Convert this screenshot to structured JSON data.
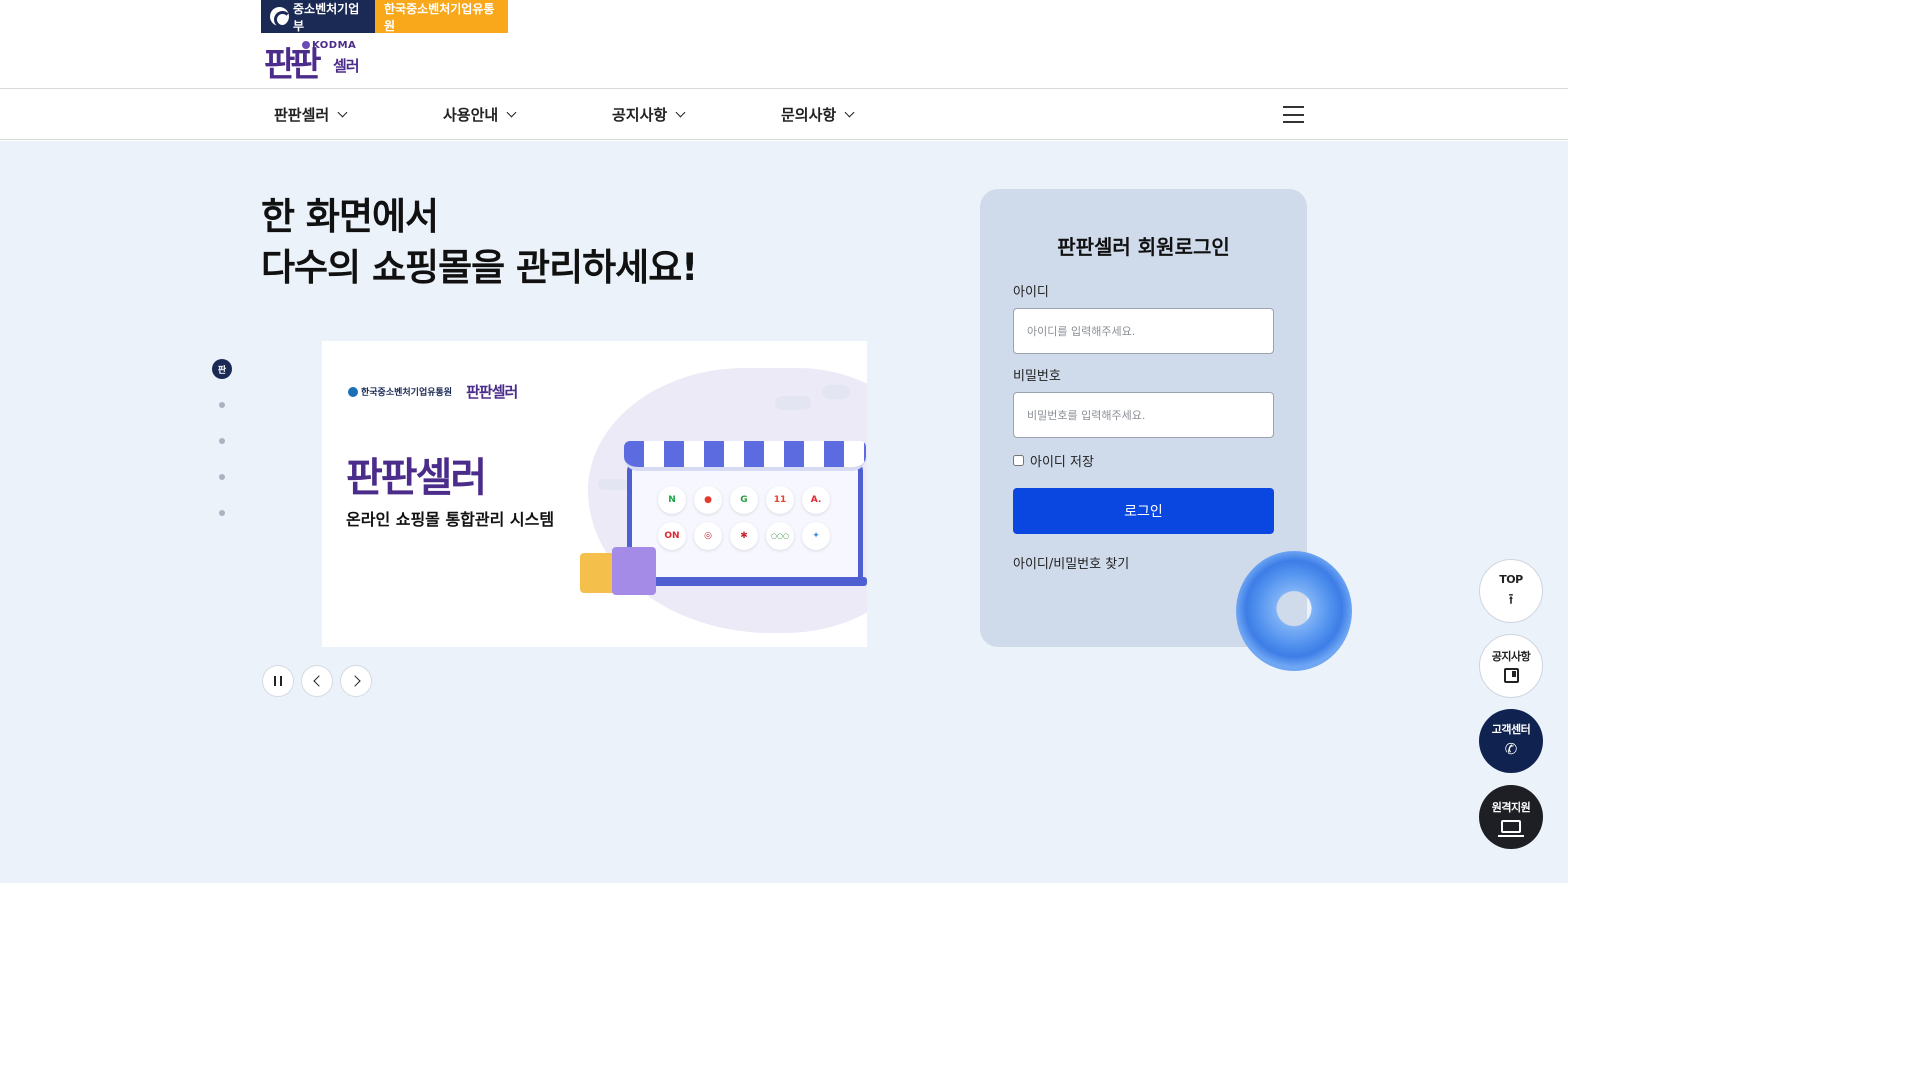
{
  "header": {
    "gov_links": [
      {
        "label": "중소벤처기업부"
      },
      {
        "label": "한국중소벤처기업유통원"
      }
    ],
    "logo": {
      "brand": "KODMA",
      "main": "판판",
      "sub": "셀러"
    }
  },
  "nav": {
    "items": [
      {
        "label": "판판셀러"
      },
      {
        "label": "사용안내"
      },
      {
        "label": "공지사항"
      },
      {
        "label": "문의사항"
      }
    ]
  },
  "hero": {
    "title_line1": "한 화면에서",
    "title_line2": "다수의 쇼핑몰을 관리하세요!"
  },
  "slider": {
    "active_dot_label": "판",
    "banner": {
      "logo_agency": "한국중소벤처기업유통원",
      "logo_service": "판판셀러",
      "title": "판판셀러",
      "subtitle": "온라인 쇼핑몰 통합관리 시스템",
      "shop_icons": [
        "N",
        "●",
        "G",
        "11",
        "A.",
        "ON",
        "◎",
        "✱",
        "○○○",
        "✦"
      ]
    }
  },
  "login": {
    "title": "판판셀러 회원로그인",
    "id_label": "아이디",
    "id_placeholder": "아이디를 입력해주세요.",
    "pw_label": "비밀번호",
    "pw_placeholder": "비밀번호를 입력해주세요.",
    "save_id_label": "아이디 저장",
    "login_button": "로그인",
    "find_link": "아이디/비밀번호 찾기"
  },
  "quick_menu": {
    "top": {
      "label": "TOP",
      "icon": "arrow-up-icon"
    },
    "notice": {
      "label": "공지사항",
      "icon": "notice-icon"
    },
    "support": {
      "label": "고객센터",
      "icon": "phone-icon"
    },
    "remote": {
      "label": "원격지원",
      "icon": "laptop-icon"
    }
  },
  "colors": {
    "navy": "#1b2a55",
    "orange": "#f9a81b",
    "brand_purple": "#4b2c8a",
    "background": "#ebf2fa",
    "login_panel": "#cfdbea",
    "primary_button": "#0a47e0"
  }
}
